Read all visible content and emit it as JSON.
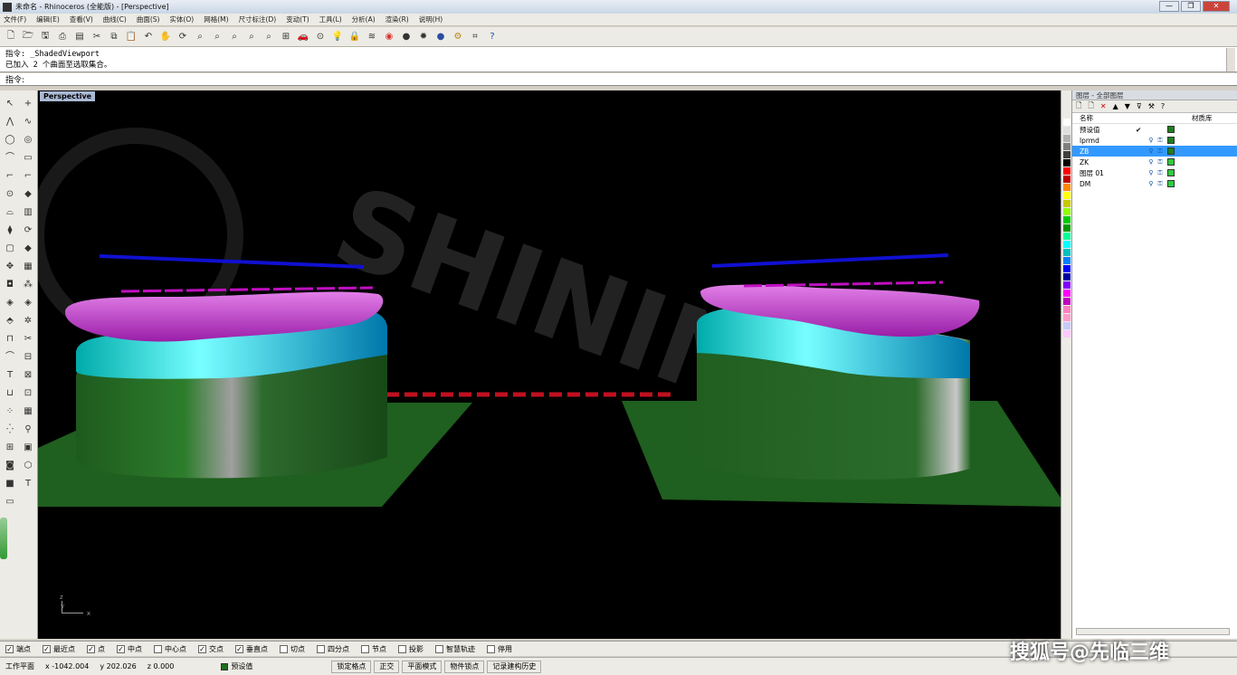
{
  "window": {
    "title": "未命名 - Rhinoceros (全能版) - [Perspective]",
    "controls": [
      "—",
      "❐",
      "✕"
    ]
  },
  "menu": [
    "文件(F)",
    "编辑(E)",
    "查看(V)",
    "曲线(C)",
    "曲面(S)",
    "实体(O)",
    "网格(M)",
    "尺寸标注(D)",
    "变动(T)",
    "工具(L)",
    "分析(A)",
    "渲染(R)",
    "说明(H)"
  ],
  "toolbar_icons": [
    "new-file-icon",
    "open-file-icon",
    "save-icon",
    "print-icon",
    "page-icon",
    "cut-icon",
    "copy-icon",
    "paste-icon",
    "undo-icon",
    "pan-icon",
    "rotate-view-icon",
    "zoom-icon",
    "zoom-window-icon",
    "zoom-extents-icon",
    "zoom-selected-icon",
    "zoom-all-icon",
    "four-view-icon",
    "car-icon",
    "target-icon",
    "lightbulb-icon",
    "lock-icon",
    "layer-icon",
    "color-wheel-icon",
    "sphere-icon",
    "settings-gear-icon",
    "render-sphere-icon",
    "gear-icon",
    "grid-icon",
    "help-icon"
  ],
  "command": {
    "history_line1": "指令: _ShadedViewport",
    "history_line2": "已加入 2 个曲面至选取集合。",
    "prompt": "指令:",
    "value": ""
  },
  "viewport": {
    "tab_label": "Perspective",
    "watermark": "SHINING 3D",
    "axis_z": "z",
    "axis_y": "y",
    "axis_x": "x"
  },
  "layer_panel": {
    "title": "图层 - 全部图层",
    "col_name": "名称",
    "col_material": "材质库",
    "layers": [
      {
        "name": "预设值",
        "color": "#1f7f1f",
        "check": "✔",
        "selected": false
      },
      {
        "name": "lprmd",
        "color": "#1f7f1f",
        "check": "",
        "selected": false
      },
      {
        "name": "ZB",
        "color": "#1f7f1f",
        "check": "",
        "selected": true
      },
      {
        "name": "ZK",
        "color": "#2ecc40",
        "check": "",
        "selected": false
      },
      {
        "name": "图层 01",
        "color": "#2ecc40",
        "check": "",
        "selected": false
      },
      {
        "name": "DM",
        "color": "#2ecc40",
        "check": "",
        "selected": false
      }
    ]
  },
  "color_swatches": [
    "#ffffff",
    "#e0e0e0",
    "#b0b0b0",
    "#808080",
    "#404040",
    "#000000",
    "#ff0000",
    "#c00000",
    "#ff8800",
    "#ffff00",
    "#c8c800",
    "#90ff00",
    "#00cc00",
    "#009900",
    "#00ff99",
    "#00ffff",
    "#00c0c0",
    "#0080ff",
    "#0000ff",
    "#0000a0",
    "#8000ff",
    "#ff00ff",
    "#c000c0",
    "#ff80c0",
    "#ff99cc",
    "#c8c8ff",
    "#ffc8ff"
  ],
  "osnap": [
    {
      "label": "端点",
      "checked": true
    },
    {
      "label": "最近点",
      "checked": true
    },
    {
      "label": "点",
      "checked": true
    },
    {
      "label": "中点",
      "checked": true
    },
    {
      "label": "中心点",
      "checked": false
    },
    {
      "label": "交点",
      "checked": true
    },
    {
      "label": "垂直点",
      "checked": true
    },
    {
      "label": "切点",
      "checked": false
    },
    {
      "label": "四分点",
      "checked": false
    },
    {
      "label": "节点",
      "checked": false
    },
    {
      "label": "投影",
      "checked": false
    },
    {
      "label": "智慧轨迹",
      "checked": false
    },
    {
      "label": "停用",
      "checked": false
    }
  ],
  "status": {
    "cplane": "工作平面",
    "x": "x -1042.004",
    "y": "y 202.026",
    "z": "z 0.000",
    "layer": "预设值",
    "panes": [
      "锁定格点",
      "正交",
      "平面模式",
      "物件锁点",
      "记录建构历史"
    ]
  },
  "overlay_watermark": "搜狐号@先临三维"
}
